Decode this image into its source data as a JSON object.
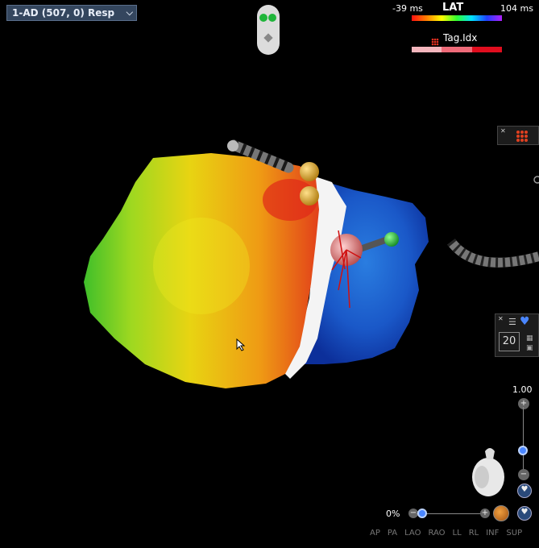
{
  "map_select": {
    "label": "1-AD (507, 0) Resp",
    "chevron": "chevron-down-icon"
  },
  "lat_scale": {
    "min_label": "-39 ms",
    "title": "LAT",
    "max_label": "104 ms",
    "colors": [
      "#ff1010",
      "#ff8000",
      "#ffff00",
      "#30ff30",
      "#00e0ff",
      "#2040ff",
      "#b020ff"
    ]
  },
  "tag_index": {
    "label": "Tag.Idx",
    "icon": "tag-grid-icon",
    "segments": [
      "#f4b6bd",
      "#ee6b79",
      "#e00d1e"
    ]
  },
  "view_panel": {
    "number": "20",
    "icons": [
      "filter-icon",
      "heart-icon",
      "grid-icon",
      "lock-icon"
    ]
  },
  "zoom": {
    "label": "1.00",
    "plus": "+",
    "minus": "−",
    "level": 0.33
  },
  "opacity": {
    "label": "0%",
    "minus": "−",
    "plus": "+",
    "level": 0.08
  },
  "view_buttons": [
    "AP",
    "PA",
    "LAO",
    "RAO",
    "LL",
    "RL",
    "INF",
    "SUP"
  ],
  "colors": {
    "accent": "#4a86ff",
    "panel": "#34465e"
  }
}
